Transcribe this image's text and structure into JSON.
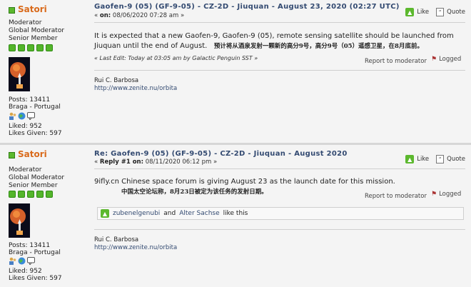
{
  "posts": [
    {
      "author": "Satori",
      "ranks": [
        "Moderator",
        "Global Moderator",
        "Senior Member"
      ],
      "stats": [
        "Posts: 13411",
        "Braga - Portugal"
      ],
      "liked": [
        "Liked: 952",
        "Likes Given: 597"
      ],
      "subject": "Gaofen-9 (05) (GF-9-05) - CZ-2D - Jiuquan - August 23, 2020 (02:27 UTC)",
      "meta_prefix": "«",
      "meta_on": "on:",
      "meta_date": "08/06/2020 07:28 am »",
      "like_label": "Like",
      "quote_label": "Quote",
      "text_line1": "It is expected that a new Gaofen-9, Gaofen-9 (05), remote sensing satellite should be launched from",
      "text_line2": "Jiuquan until the end of August.",
      "text_cn": "预计将从酒泉发射一颗新的高分9号，高分9号（05）遥感卫星，在8月底前。",
      "last_edit": "« Last Edit: Today at 03:05 am by Galactic Penguin SST »",
      "report": "Report to moderator",
      "logged": "Logged",
      "sig_name": "Rui C. Barbosa",
      "sig_url": "http://www.zenite.nu/orbita"
    },
    {
      "author": "Satori",
      "ranks": [
        "Moderator",
        "Global Moderator",
        "Senior Member"
      ],
      "stats": [
        "Posts: 13411",
        "Braga - Portugal"
      ],
      "liked": [
        "Liked: 952",
        "Likes Given: 597"
      ],
      "subject": "Re: Gaofen-9 (05) (GF-9-05) - CZ-2D - Jiuquan - August 2020",
      "meta_prefix": "«",
      "meta_on": "Reply #1 on:",
      "meta_date": "08/11/2020 06:12 pm »",
      "like_label": "Like",
      "quote_label": "Quote",
      "text_line1": "9ifly.cn Chinese space forum is giving August 23 as the launch date for this mission.",
      "text_cn": "中国太空论坛称，8月23日被定为该任务的发射日期。",
      "report": "Report to moderator",
      "logged": "Logged",
      "likers": {
        "a": "zubenelgenubi",
        "and": "and",
        "b": "Alter Sachse",
        "tail": "like this"
      },
      "sig_name": "Rui C. Barbosa",
      "sig_url": "http://www.zenite.nu/orbita"
    }
  ],
  "colors": {
    "author": "#d96a1b",
    "subject": "#334a71",
    "online": "#5cb82e"
  }
}
